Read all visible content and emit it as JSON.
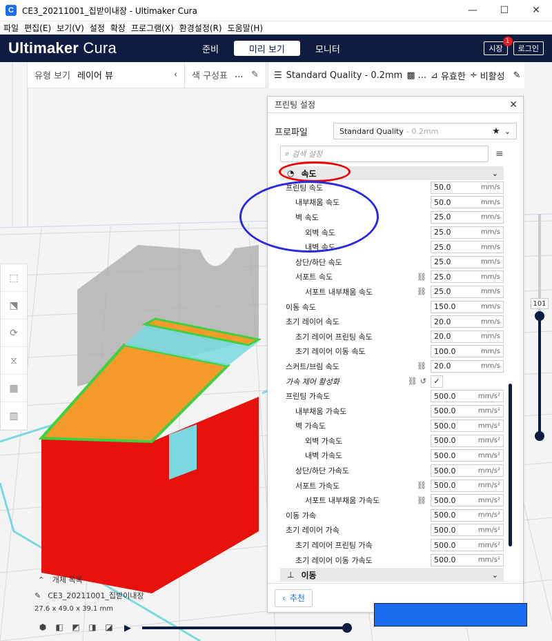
{
  "window": {
    "title": "CE3_20211001_집받이내장 - Ultimaker Cura",
    "controls": {
      "minimize": "—",
      "maximize": "☐",
      "close": "✕"
    }
  },
  "menu": [
    "파일",
    "편집(E)",
    "보기(V)",
    "설정",
    "확장",
    "프로그램(X)",
    "환경설정(R)",
    "도움말(H)"
  ],
  "header": {
    "logo_bold": "Ultimaker",
    "logo_light": " Cura",
    "stages": [
      "준비",
      "미리 보기",
      "모니터"
    ],
    "active_stage": 1,
    "market_label": "시장",
    "market_badge": "1",
    "login_label": "로그인"
  },
  "viewbar": {
    "view_type_label": "유형 보기",
    "view_type_value": "레이어 뷰",
    "color_scheme_label": "색 구성표",
    "color_scheme_value": "..."
  },
  "quality_bar": {
    "profile": "Standard Quality - 0.2mm",
    "infill": "...",
    "support": "유효한",
    "adhesion": "비활성"
  },
  "panel": {
    "title": "프린팅 설정",
    "profile_label": "프로파일",
    "profile_value": "Standard Quality",
    "profile_sub": "- 0.2mm",
    "search_placeholder": "검색 설정",
    "category_speed": "속도",
    "category_travel": "이동",
    "recommend_label": "추천",
    "settings": [
      {
        "label": "프린팅 속도",
        "indent": 0,
        "value": "50.0",
        "unit": "mm/s"
      },
      {
        "label": "내부채움 속도",
        "indent": 1,
        "value": "50.0",
        "unit": "mm/s"
      },
      {
        "label": "벽 속도",
        "indent": 1,
        "value": "25.0",
        "unit": "mm/s"
      },
      {
        "label": "외벽 속도",
        "indent": 2,
        "value": "25.0",
        "unit": "mm/s"
      },
      {
        "label": "내벽 속도",
        "indent": 2,
        "value": "25.0",
        "unit": "mm/s"
      },
      {
        "label": "상단/하단 속도",
        "indent": 1,
        "value": "25.0",
        "unit": "mm/s"
      },
      {
        "label": "서포트 속도",
        "indent": 1,
        "value": "25.0",
        "unit": "mm/s",
        "link": true
      },
      {
        "label": "서포트 내부채움 속도",
        "indent": 2,
        "value": "25.0",
        "unit": "mm/s",
        "link": true
      },
      {
        "label": "이동 속도",
        "indent": 0,
        "value": "150.0",
        "unit": "mm/s"
      },
      {
        "label": "초기 레이어 속도",
        "indent": 0,
        "value": "20.0",
        "unit": "mm/s"
      },
      {
        "label": "초기 레이어 프린팅 속도",
        "indent": 1,
        "value": "20.0",
        "unit": "mm/s"
      },
      {
        "label": "초기 레이어 이동 속도",
        "indent": 1,
        "value": "100.0",
        "unit": "mm/s"
      },
      {
        "label": "스커트/브림 속도",
        "indent": 0,
        "value": "20.0",
        "unit": "mm/s",
        "link": true
      },
      {
        "label": "가속 제어 활성화",
        "indent": 0,
        "checkbox": true,
        "checked": "✓",
        "link": true,
        "reset": true,
        "italic": true
      },
      {
        "label": "프린팅 가속도",
        "indent": 0,
        "value": "500.0",
        "unit": "mm/s²"
      },
      {
        "label": "내부채움 가속도",
        "indent": 1,
        "value": "500.0",
        "unit": "mm/s²"
      },
      {
        "label": "벽 가속도",
        "indent": 1,
        "value": "500.0",
        "unit": "mm/s²"
      },
      {
        "label": "외벽 가속도",
        "indent": 2,
        "value": "500.0",
        "unit": "mm/s²"
      },
      {
        "label": "내벽 가속도",
        "indent": 2,
        "value": "500.0",
        "unit": "mm/s²"
      },
      {
        "label": "상단/하단 가속도",
        "indent": 1,
        "value": "500.0",
        "unit": "mm/s²"
      },
      {
        "label": "서포트 가속도",
        "indent": 1,
        "value": "500.0",
        "unit": "mm/s²",
        "link": true
      },
      {
        "label": "서포트 내부채움 가속도",
        "indent": 2,
        "value": "500.0",
        "unit": "mm/s²",
        "link": true
      },
      {
        "label": "이동 가속",
        "indent": 0,
        "value": "500.0",
        "unit": "mm/s²"
      },
      {
        "label": "초기 레이어 가속",
        "indent": 0,
        "value": "500.0",
        "unit": "mm/s²"
      },
      {
        "label": "초기 레이어 프린팅 가속",
        "indent": 1,
        "value": "500.0",
        "unit": "mm/s²"
      },
      {
        "label": "초기 레이어 이동 가속도",
        "indent": 1,
        "value": "500.0",
        "unit": "mm/s²"
      }
    ]
  },
  "layer_slider": {
    "value": "101"
  },
  "object": {
    "list_label": "개체 목록",
    "name": "CE3_20211001_집받이내장",
    "dims": "27.6 x 49.0 x 39.1 mm"
  },
  "colors": {
    "header_bg": "#0e1c41",
    "accent": "#196ef0",
    "model_red": "#e8120c",
    "infill_orange": "#f59a2a",
    "skin_green": "#3fd13f",
    "travel_cyan": "#7ad9e0"
  }
}
